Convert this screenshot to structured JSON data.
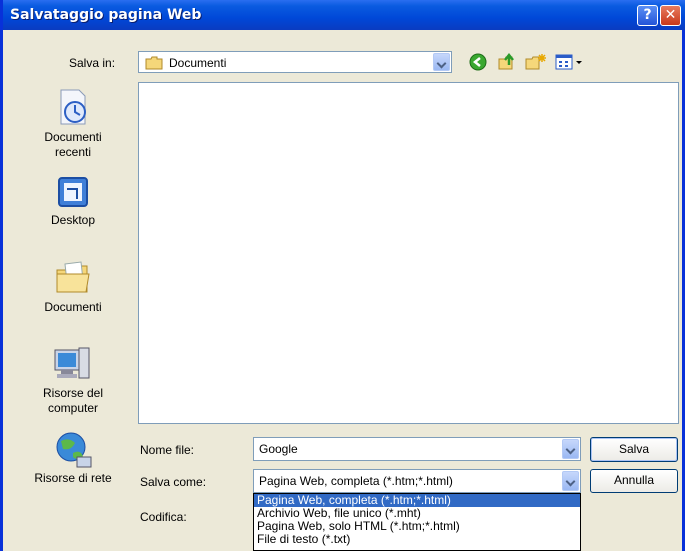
{
  "window": {
    "title": "Salvataggio pagina Web"
  },
  "toolbar": {
    "save_in_label": "Salva in:",
    "save_in_value": "Documenti"
  },
  "places": [
    {
      "label_line1": "Documenti",
      "label_line2": "recenti"
    },
    {
      "label_line1": "Desktop",
      "label_line2": ""
    },
    {
      "label_line1": "Documenti",
      "label_line2": ""
    },
    {
      "label_line1": "Risorse del",
      "label_line2": "computer"
    },
    {
      "label_line1": "Risorse di rete",
      "label_line2": ""
    }
  ],
  "form": {
    "filename_label": "Nome file:",
    "filename_value": "Google",
    "saveas_label": "Salva come:",
    "saveas_value": "Pagina Web, completa (*.htm;*.html)",
    "encoding_label": "Codifica:"
  },
  "buttons": {
    "save": "Salva",
    "cancel": "Annulla"
  },
  "saveas_options": [
    "Pagina Web, completa (*.htm;*.html)",
    "Archivio Web, file unico (*.mht)",
    "Pagina Web, solo HTML (*.htm;*.html)",
    "File di testo (*.txt)"
  ],
  "colors": {
    "titlebar": "#0a5be0",
    "selection": "#316ac5",
    "dialog_bg": "#ece9d8"
  }
}
